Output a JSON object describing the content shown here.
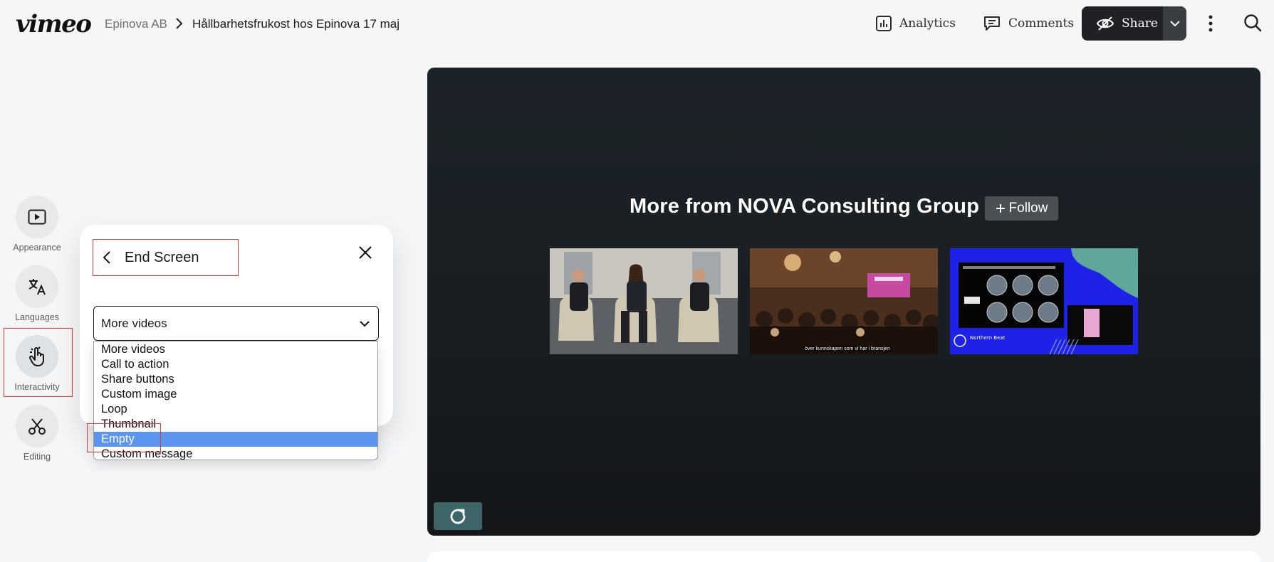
{
  "app": {
    "logo": "vimeo"
  },
  "breadcrumb": {
    "owner": "Epinova AB",
    "title": "Hållbarhetsfrukost hos Epinova 17 maj"
  },
  "toolbar": {
    "analytics_label": "Analytics",
    "comments_label": "Comments",
    "share_label": "Share"
  },
  "rail": {
    "items": [
      {
        "label": "Appearance",
        "icon": "play-square-icon"
      },
      {
        "label": "Languages",
        "icon": "translate-icon"
      },
      {
        "label": "Interactivity",
        "icon": "tap-hand-icon"
      },
      {
        "label": "Editing",
        "icon": "scissors-icon"
      }
    ]
  },
  "panel": {
    "title": "End Screen",
    "select_value": "More videos",
    "options": [
      "More videos",
      "Call to action",
      "Share buttons",
      "Custom image",
      "Loop",
      "Thumbnail",
      "Empty",
      "Custom message"
    ],
    "highlighted_option": "Empty"
  },
  "player": {
    "heading": "More from NOVA Consulting Group",
    "follow_label": "Follow",
    "thumbnail_caption": "över kunnskapen som vi har i bransjen",
    "thumbnail_3_label": "Northern Beat"
  },
  "colors": {
    "accent_highlight": "#e53935",
    "selected_option": "#5b95f0",
    "share_bg": "#1f2124",
    "replay_bg": "#3e6567"
  }
}
